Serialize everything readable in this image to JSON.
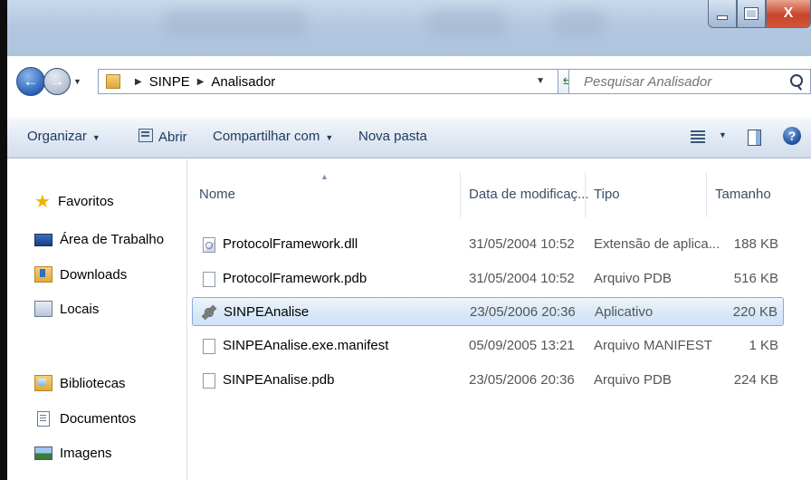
{
  "window": {
    "controls": {
      "minimize": "",
      "maximize": "",
      "close": "X"
    }
  },
  "address": {
    "crumbs": [
      "SINPE",
      "Analisador"
    ],
    "search_placeholder": "Pesquisar Analisador"
  },
  "toolbar": {
    "organize": "Organizar",
    "open": "Abrir",
    "share": "Compartilhar com",
    "new_folder": "Nova pasta"
  },
  "sidebar": {
    "favorites_header": "Favoritos",
    "favorites": [
      {
        "label": "Área de Trabalho",
        "icon": "desktop-icon"
      },
      {
        "label": "Downloads",
        "icon": "downloads-folder-icon"
      },
      {
        "label": "Locais",
        "icon": "recent-places-icon"
      }
    ],
    "libraries_header": "Bibliotecas",
    "libraries": [
      {
        "label": "Documentos",
        "icon": "document-icon"
      },
      {
        "label": "Imagens",
        "icon": "image-icon"
      }
    ]
  },
  "columns": {
    "name": "Nome",
    "date": "Data de modificaç...",
    "type": "Tipo",
    "size": "Tamanho"
  },
  "files": [
    {
      "name": "ProtocolFramework.dll",
      "date": "31/05/2004 10:52",
      "type": "Extensão de aplica...",
      "size": "188 KB",
      "icon": "dll-file-icon",
      "selected": false
    },
    {
      "name": "ProtocolFramework.pdb",
      "date": "31/05/2004 10:52",
      "type": "Arquivo PDB",
      "size": "516 KB",
      "icon": "file-icon",
      "selected": false
    },
    {
      "name": "SINPEAnalise",
      "date": "23/05/2006 20:36",
      "type": "Aplicativo",
      "size": "220 KB",
      "icon": "application-icon",
      "selected": true
    },
    {
      "name": "SINPEAnalise.exe.manifest",
      "date": "05/09/2005 13:21",
      "type": "Arquivo MANIFEST",
      "size": "1 KB",
      "icon": "file-icon",
      "selected": false
    },
    {
      "name": "SINPEAnalise.pdb",
      "date": "23/05/2006 20:36",
      "type": "Arquivo PDB",
      "size": "224 KB",
      "icon": "file-icon",
      "selected": false
    }
  ]
}
